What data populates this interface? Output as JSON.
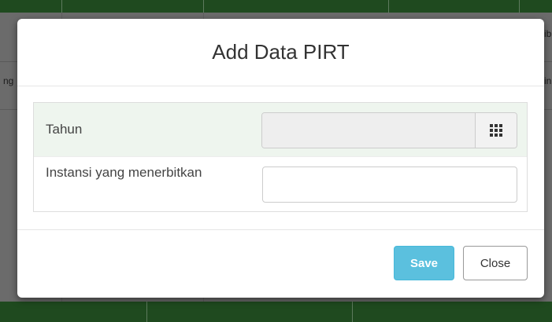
{
  "modal": {
    "title": "Add Data PIRT",
    "fields": [
      {
        "label": "Tahun",
        "value": "",
        "placeholder": ""
      },
      {
        "label": "Instansi yang menerbitkan",
        "value": "",
        "placeholder": ""
      }
    ],
    "calendar_icon": "calendar-grid-icon",
    "buttons": {
      "save": "Save",
      "close": "Close"
    }
  },
  "background": {
    "fragments": [
      "ib",
      "ng",
      "in"
    ]
  },
  "colors": {
    "header_green": "#1f4a1f",
    "row_highlight": "#eef5ee",
    "save_button": "#5bc0de",
    "overlay": "#6b6b6b"
  }
}
